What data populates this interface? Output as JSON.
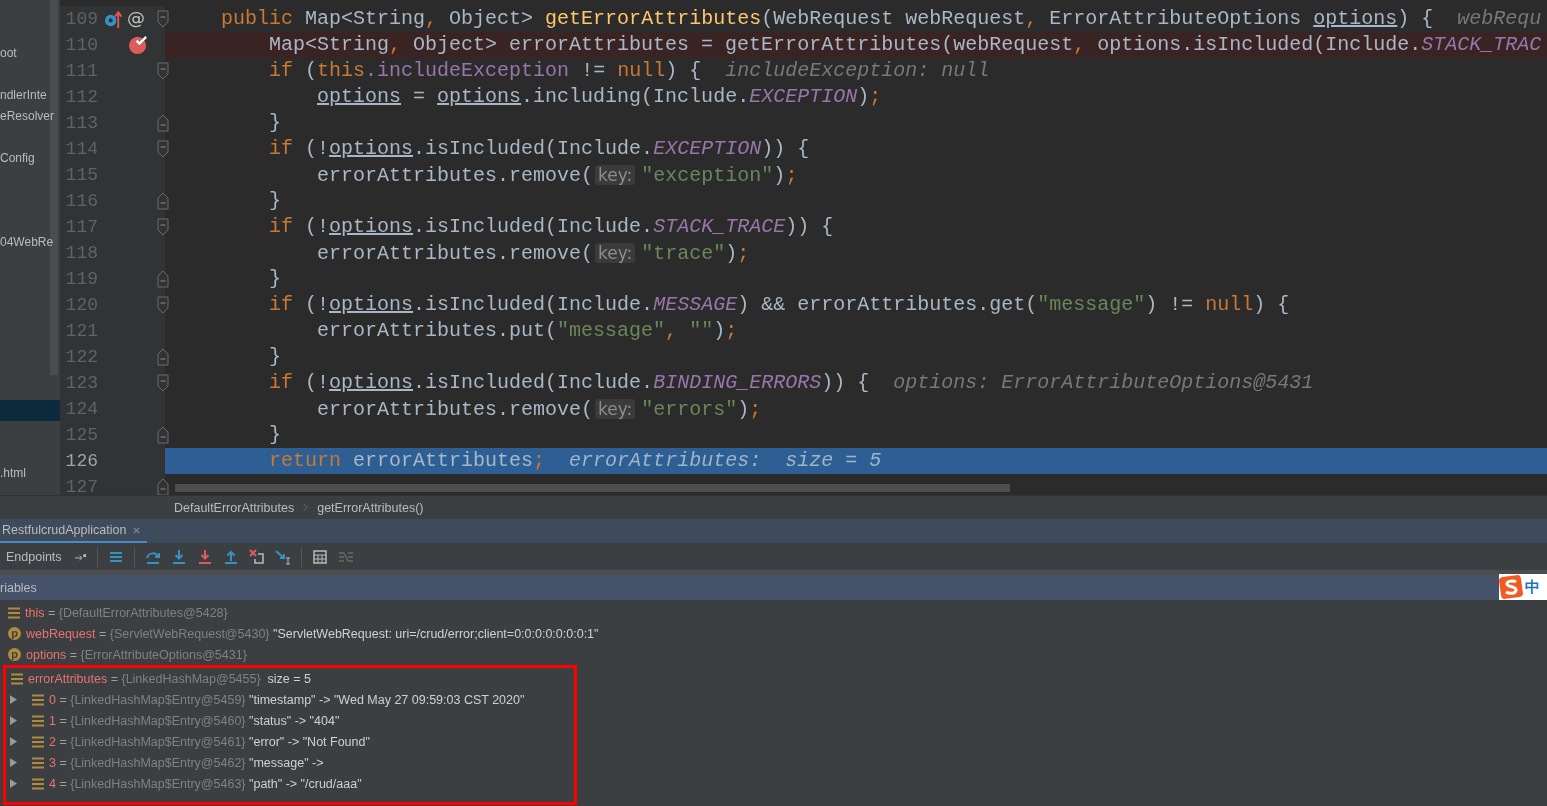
{
  "project_tree": [
    {
      "label": "oot",
      "selected": false
    },
    {
      "selected": false
    },
    {
      "label": "ndlerInte",
      "selected": false
    },
    {
      "label": "eResolver",
      "selected": false
    },
    {
      "selected": false
    },
    {
      "label": "Config",
      "selected": false
    },
    {
      "selected": false
    },
    {
      "selected": false
    },
    {
      "selected": false
    },
    {
      "label": "04WebRe",
      "selected": false
    },
    {
      "selected": false
    },
    {
      "selected": false
    },
    {
      "selected": false
    },
    {
      "selected": false
    },
    {
      "selected": false
    },
    {
      "selected": false
    },
    {
      "selected": false
    },
    {
      "selected": true
    },
    {
      "selected": false
    },
    {
      "selected": false
    },
    {
      "label": ".html",
      "selected": false
    }
  ],
  "editor": {
    "lines": [
      {
        "number": "109",
        "breakpoint": false,
        "current": false,
        "override_marker": true,
        "gutter_glyph": "@",
        "fold_start": true,
        "tokens": [
          {
            "text": "    public",
            "kind": "kw"
          },
          {
            "text": " Map<String",
            "kind": "plain"
          },
          {
            "text": ", ",
            "kind": "kw"
          },
          {
            "text": "Object> ",
            "kind": "plain"
          },
          {
            "text": "getErrorAttributes",
            "kind": "fn"
          },
          {
            "text": "(WebRequest webRequest",
            "kind": "plain"
          },
          {
            "text": ", ",
            "kind": "kw"
          },
          {
            "text": "ErrorAttributeOptions ",
            "kind": "plain"
          },
          {
            "text": "options",
            "kind": "underlined"
          },
          {
            "text": ") {",
            "kind": "plain"
          },
          {
            "text": "  webRequ",
            "kind": "debug"
          }
        ]
      },
      {
        "number": "110",
        "breakpoint": true,
        "current": false,
        "override_marker": false,
        "tokens": [
          {
            "text": "        Map<String",
            "kind": "plain"
          },
          {
            "text": ", ",
            "kind": "kw"
          },
          {
            "text": "Object> errorAttributes = getErrorAttributes(webRequest",
            "kind": "plain"
          },
          {
            "text": ", ",
            "kind": "kw"
          },
          {
            "text": "options.isIncluded(Include.",
            "kind": "plain"
          },
          {
            "text": "STACK_TRAC",
            "kind": "const"
          }
        ]
      },
      {
        "number": "111",
        "breakpoint": false,
        "current": false,
        "override_marker": false,
        "fold_start": true,
        "tokens": [
          {
            "text": "        if",
            "kind": "kw"
          },
          {
            "text": " (",
            "kind": "plain"
          },
          {
            "text": "this",
            "kind": "kw"
          },
          {
            "text": ".includeException",
            "kind": "field"
          },
          {
            "text": " != ",
            "kind": "plain"
          },
          {
            "text": "null",
            "kind": "kw"
          },
          {
            "text": ") {",
            "kind": "plain"
          },
          {
            "text": "  includeException: null",
            "kind": "debug"
          }
        ]
      },
      {
        "number": "112",
        "breakpoint": false,
        "current": false,
        "override_marker": false,
        "tokens": [
          {
            "text": "            options",
            "kind": "underlined"
          },
          {
            "text": " = ",
            "kind": "plain"
          },
          {
            "text": "options",
            "kind": "underlined"
          },
          {
            "text": ".including(Include.",
            "kind": "plain"
          },
          {
            "text": "EXCEPTION",
            "kind": "const"
          },
          {
            "text": ")",
            "kind": "plain"
          },
          {
            "text": ";",
            "kind": "kw"
          }
        ]
      },
      {
        "number": "113",
        "breakpoint": false,
        "current": false,
        "override_marker": false,
        "fold_end": true,
        "tokens": [
          {
            "text": "        }",
            "kind": "plain"
          }
        ]
      },
      {
        "number": "114",
        "breakpoint": false,
        "current": false,
        "override_marker": false,
        "fold_start": true,
        "tokens": [
          {
            "text": "        if",
            "kind": "kw"
          },
          {
            "text": " (!",
            "kind": "plain"
          },
          {
            "text": "options",
            "kind": "underlined"
          },
          {
            "text": ".isIncluded(Include.",
            "kind": "plain"
          },
          {
            "text": "EXCEPTION",
            "kind": "const"
          },
          {
            "text": ")) {",
            "kind": "plain"
          }
        ]
      },
      {
        "number": "115",
        "breakpoint": false,
        "current": false,
        "override_marker": false,
        "tokens": [
          {
            "text": "            errorAttributes.remove(",
            "kind": "plain"
          },
          {
            "text": "key:",
            "kind": "hint"
          },
          {
            "text": "\"exception\"",
            "kind": "str"
          },
          {
            "text": ")",
            "kind": "plain"
          },
          {
            "text": ";",
            "kind": "kw"
          }
        ]
      },
      {
        "number": "116",
        "breakpoint": false,
        "current": false,
        "override_marker": false,
        "fold_end": true,
        "tokens": [
          {
            "text": "        }",
            "kind": "plain"
          }
        ]
      },
      {
        "number": "117",
        "breakpoint": false,
        "current": false,
        "override_marker": false,
        "fold_start": true,
        "tokens": [
          {
            "text": "        if",
            "kind": "kw"
          },
          {
            "text": " (!",
            "kind": "plain"
          },
          {
            "text": "options",
            "kind": "underlined"
          },
          {
            "text": ".isIncluded(Include.",
            "kind": "plain"
          },
          {
            "text": "STACK_TRACE",
            "kind": "const"
          },
          {
            "text": ")) {",
            "kind": "plain"
          }
        ]
      },
      {
        "number": "118",
        "breakpoint": false,
        "current": false,
        "override_marker": false,
        "tokens": [
          {
            "text": "            errorAttributes.remove(",
            "kind": "plain"
          },
          {
            "text": "key:",
            "kind": "hint"
          },
          {
            "text": "\"trace\"",
            "kind": "str"
          },
          {
            "text": ")",
            "kind": "plain"
          },
          {
            "text": ";",
            "kind": "kw"
          }
        ]
      },
      {
        "number": "119",
        "breakpoint": false,
        "current": false,
        "override_marker": false,
        "fold_end": true,
        "tokens": [
          {
            "text": "        }",
            "kind": "plain"
          }
        ]
      },
      {
        "number": "120",
        "breakpoint": false,
        "current": false,
        "override_marker": false,
        "fold_start": true,
        "tokens": [
          {
            "text": "        if",
            "kind": "kw"
          },
          {
            "text": " (!",
            "kind": "plain"
          },
          {
            "text": "options",
            "kind": "underlined"
          },
          {
            "text": ".isIncluded(Include.",
            "kind": "plain"
          },
          {
            "text": "MESSAGE",
            "kind": "const"
          },
          {
            "text": ") && errorAttributes.get(",
            "kind": "plain"
          },
          {
            "text": "\"message\"",
            "kind": "str"
          },
          {
            "text": ") != ",
            "kind": "plain"
          },
          {
            "text": "null",
            "kind": "kw"
          },
          {
            "text": ") {",
            "kind": "plain"
          }
        ]
      },
      {
        "number": "121",
        "breakpoint": false,
        "current": false,
        "override_marker": false,
        "tokens": [
          {
            "text": "            errorAttributes.put(",
            "kind": "plain"
          },
          {
            "text": "\"message\"",
            "kind": "str"
          },
          {
            "text": ", ",
            "kind": "kw"
          },
          {
            "text": "\"\"",
            "kind": "str"
          },
          {
            "text": ")",
            "kind": "plain"
          },
          {
            "text": ";",
            "kind": "kw"
          }
        ]
      },
      {
        "number": "122",
        "breakpoint": false,
        "current": false,
        "override_marker": false,
        "fold_end": true,
        "tokens": [
          {
            "text": "        }",
            "kind": "plain"
          }
        ]
      },
      {
        "number": "123",
        "breakpoint": false,
        "current": false,
        "override_marker": false,
        "fold_start": true,
        "tokens": [
          {
            "text": "        if",
            "kind": "kw"
          },
          {
            "text": " (!",
            "kind": "plain"
          },
          {
            "text": "options",
            "kind": "underlined"
          },
          {
            "text": ".isIncluded(Include.",
            "kind": "plain"
          },
          {
            "text": "BINDING_ERRORS",
            "kind": "const"
          },
          {
            "text": ")) {",
            "kind": "plain"
          },
          {
            "text": "  options: ErrorAttributeOptions@5431",
            "kind": "debug"
          }
        ]
      },
      {
        "number": "124",
        "breakpoint": false,
        "current": false,
        "override_marker": false,
        "tokens": [
          {
            "text": "            errorAttributes.remove(",
            "kind": "plain"
          },
          {
            "text": "key:",
            "kind": "hint"
          },
          {
            "text": "\"errors\"",
            "kind": "str"
          },
          {
            "text": ")",
            "kind": "plain"
          },
          {
            "text": ";",
            "kind": "kw"
          }
        ]
      },
      {
        "number": "125",
        "breakpoint": false,
        "current": false,
        "override_marker": false,
        "fold_end": true,
        "tokens": [
          {
            "text": "        }",
            "kind": "plain"
          }
        ]
      },
      {
        "number": "126",
        "breakpoint": false,
        "current": true,
        "override_marker": false,
        "tokens": [
          {
            "text": "        return",
            "kind": "kw"
          },
          {
            "text": " errorAttributes",
            "kind": "plain"
          },
          {
            "text": ";",
            "kind": "kw"
          },
          {
            "text": "  errorAttributes:  size = 5",
            "kind": "debug"
          }
        ]
      },
      {
        "number": "127",
        "breakpoint": false,
        "current": false,
        "override_marker": false,
        "fold_end": true
      }
    ]
  },
  "breadcrumbs": [
    "DefaultErrorAttributes",
    "getErrorAttributes()"
  ],
  "debug_tabs": [
    {
      "label": "RestfulcrudApplication",
      "selected": true
    }
  ],
  "debug_toolbar": {
    "endpoints_label": "Endpoints"
  },
  "variables_header": "riables",
  "ime_indicator": {
    "label": "中"
  },
  "variables": [
    {
      "kind": "field",
      "name": "this",
      "assign": "=",
      "type": "{DefaultErrorAttributes@5428}"
    },
    {
      "kind": "param",
      "badge": "p",
      "name": "webRequest",
      "assign": "=",
      "type": "{ServletWebRequest@5430}",
      "value": "\"ServletWebRequest: uri=/crud/error;client=0:0:0:0:0:0:0:1\""
    },
    {
      "kind": "param",
      "badge": "p",
      "name": "options",
      "assign": "=",
      "type": "{ErrorAttributeOptions@5431}"
    },
    {
      "kind": "field",
      "name": "errorAttributes",
      "assign": "=",
      "type": "{LinkedHashMap@5455}",
      "value": "size = 5",
      "boxed": true,
      "children": [
        {
          "kind": "field",
          "name": "0",
          "assign": "=",
          "type": "{LinkedHashMap$Entry@5459}",
          "value": "\"timestamp\" -> \"Wed May 27 09:59:03 CST 2020\"",
          "expanded": false
        },
        {
          "kind": "field",
          "name": "1",
          "assign": "=",
          "type": "{LinkedHashMap$Entry@5460}",
          "value": "\"status\" -> \"404\"",
          "expanded": false
        },
        {
          "kind": "field",
          "name": "2",
          "assign": "=",
          "type": "{LinkedHashMap$Entry@5461}",
          "value": "\"error\" -> \"Not Found\"",
          "expanded": false
        },
        {
          "kind": "field",
          "name": "3",
          "assign": "=",
          "type": "{LinkedHashMap$Entry@5462}",
          "value": "\"message\" ->",
          "expanded": false
        },
        {
          "kind": "field",
          "name": "4",
          "assign": "=",
          "type": "{LinkedHashMap$Entry@5463}",
          "value": "\"path\" -> \"/crud/aaa\"",
          "expanded": false
        }
      ]
    }
  ]
}
